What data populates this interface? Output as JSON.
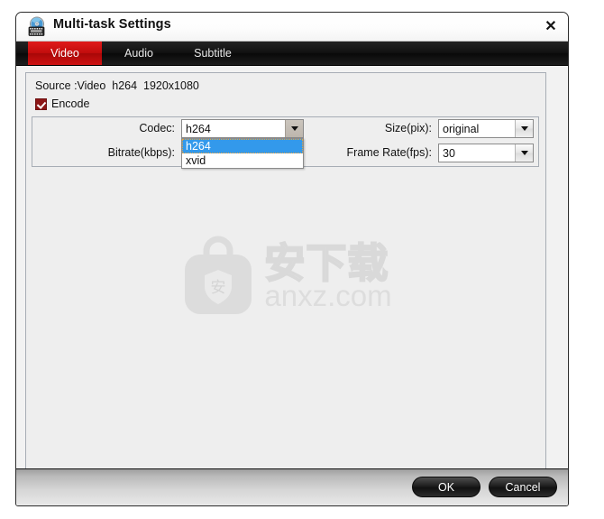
{
  "window": {
    "title": "Multi-task Settings",
    "app_icon": "disc-film-icon",
    "close_label": "✕"
  },
  "tabs": [
    {
      "label": "Video",
      "active": true
    },
    {
      "label": "Audio",
      "active": false
    },
    {
      "label": "Subtitle",
      "active": false
    }
  ],
  "video_panel": {
    "source_line": "Source :Video  h264  1920x1080",
    "encode": {
      "label": "Encode",
      "checked": true
    },
    "fields": {
      "codec": {
        "label": "Codec:",
        "value": "h264",
        "expanded": true,
        "options": [
          "h264",
          "xvid"
        ],
        "selected_index": 0
      },
      "bitrate": {
        "label": "Bitrate(kbps):",
        "value": ""
      },
      "size": {
        "label": "Size(pix):",
        "value": "original"
      },
      "frame_rate": {
        "label": "Frame Rate(fps):",
        "value": "30"
      }
    }
  },
  "watermark": {
    "logo_icon": "shield-bag-icon",
    "cn_text": "安下载",
    "shield_char": "安",
    "url_text": "anxz.com"
  },
  "footer": {
    "ok_label": "OK",
    "cancel_label": "Cancel"
  },
  "colors": {
    "accent_red": "#c10c0c",
    "tabstrip_dark": "#111111",
    "highlight_blue": "#3399eb",
    "checkbox_red": "#8c1616",
    "panel_gray": "#eeeeee"
  }
}
